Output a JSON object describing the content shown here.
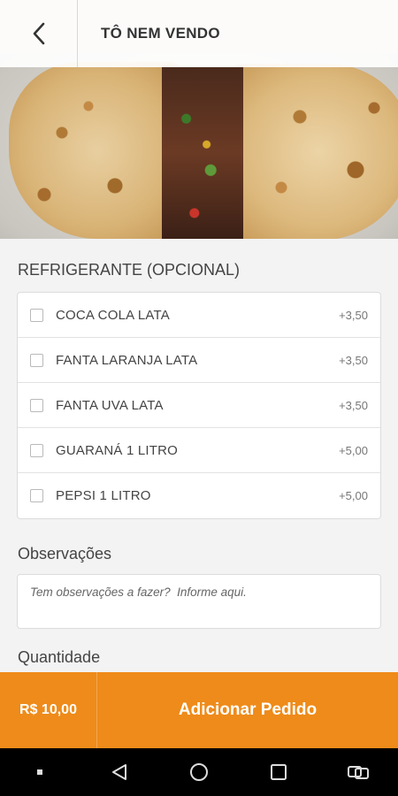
{
  "header": {
    "title": "TÔ NEM VENDO",
    "back_icon": "chevron-left-icon"
  },
  "optional_group": {
    "title": "REFRIGERANTE (OPCIONAL)",
    "items": [
      {
        "label": "COCA COLA LATA",
        "price": "+3,50",
        "checked": false
      },
      {
        "label": "FANTA LARANJA LATA",
        "price": "+3,50",
        "checked": false
      },
      {
        "label": "FANTA UVA LATA",
        "price": "+3,50",
        "checked": false
      },
      {
        "label": "GUARANÁ 1 LITRO",
        "price": "+5,00",
        "checked": false
      },
      {
        "label": "PEPSI 1 LITRO",
        "price": "+5,00",
        "checked": false
      }
    ]
  },
  "observations": {
    "label": "Observações",
    "placeholder": "Tem observações a fazer?  Informe aqui.",
    "value": ""
  },
  "quantity": {
    "label": "Quantidade"
  },
  "order_bar": {
    "total": "R$ 10,00",
    "button_label": "Adicionar Pedido",
    "accent_color": "#ee8b1a"
  },
  "system_nav": {
    "icons": [
      "square-dot-icon",
      "back-triangle-icon",
      "home-circle-icon",
      "recents-square-icon",
      "screen-rotate-icon"
    ]
  }
}
